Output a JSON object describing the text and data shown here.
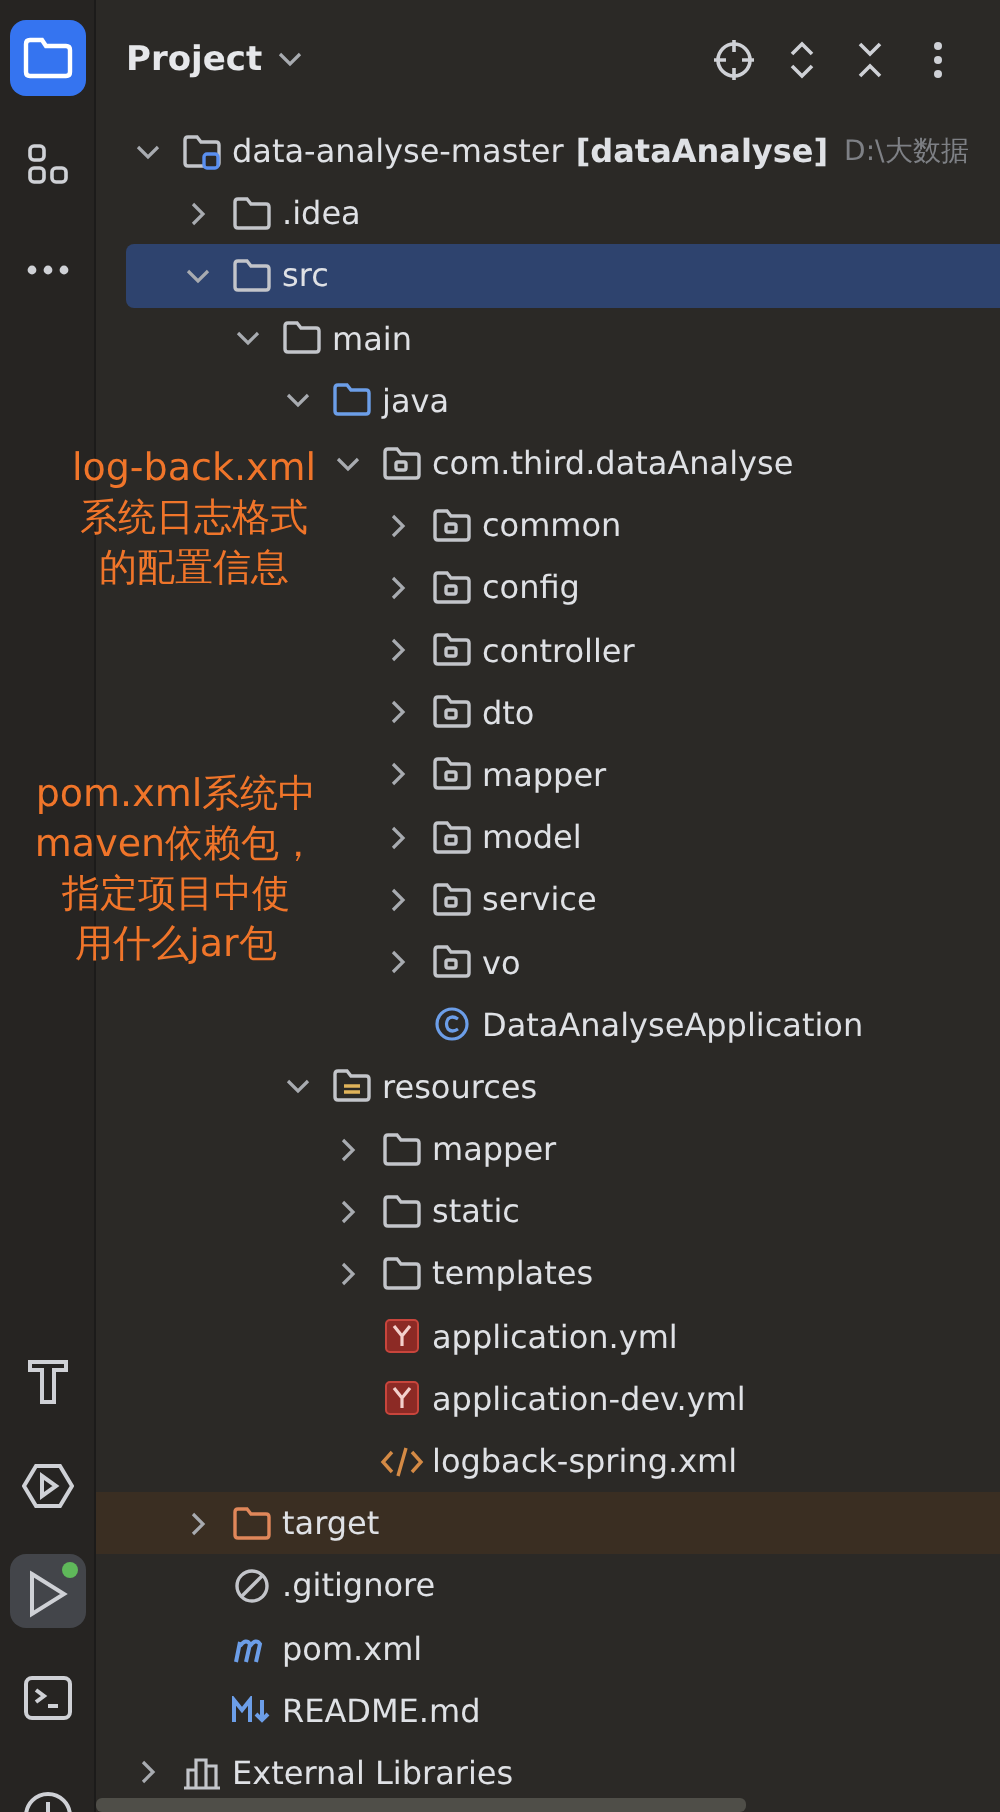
{
  "tool_strip": {
    "top": [
      {
        "kind": "project",
        "selected": true
      },
      {
        "kind": "structure",
        "selected": false
      },
      {
        "kind": "more",
        "selected": false
      }
    ],
    "bottom": [
      {
        "kind": "build",
        "selected": false,
        "status_dot": false
      },
      {
        "kind": "services",
        "selected": false,
        "status_dot": false
      },
      {
        "kind": "run",
        "selected": true,
        "status_dot": true
      },
      {
        "kind": "terminal",
        "selected": false,
        "status_dot": false
      },
      {
        "kind": "problems",
        "selected": false,
        "status_dot": false
      }
    ]
  },
  "panel": {
    "title": "Project",
    "actions": [
      {
        "kind": "locate"
      },
      {
        "kind": "expand-collapse"
      },
      {
        "kind": "collapse-all"
      },
      {
        "kind": "more"
      }
    ]
  },
  "tree": [
    {
      "kind": "module",
      "name": "data-analyse-master",
      "module": "[dataAnalyse]",
      "path": "D:\\大数据",
      "expanded": true,
      "selected": false,
      "children": [
        {
          "kind": "folder",
          "name": ".idea",
          "expanded": false,
          "selected": false
        },
        {
          "kind": "folder",
          "name": "src",
          "expanded": true,
          "selected": true,
          "children": [
            {
              "kind": "folder",
              "name": "main",
              "expanded": true,
              "selected": false,
              "children": [
                {
                  "kind": "source-folder",
                  "name": "java",
                  "expanded": true,
                  "selected": false,
                  "children": [
                    {
                      "kind": "package",
                      "name": "com.third.dataAnalyse",
                      "expanded": true,
                      "selected": false,
                      "children": [
                        {
                          "kind": "package",
                          "name": "common",
                          "expanded": false,
                          "selected": false
                        },
                        {
                          "kind": "package",
                          "name": "config",
                          "expanded": false,
                          "selected": false
                        },
                        {
                          "kind": "package",
                          "name": "controller",
                          "expanded": false,
                          "selected": false
                        },
                        {
                          "kind": "package",
                          "name": "dto",
                          "expanded": false,
                          "selected": false
                        },
                        {
                          "kind": "package",
                          "name": "mapper",
                          "expanded": false,
                          "selected": false
                        },
                        {
                          "kind": "package",
                          "name": "model",
                          "expanded": false,
                          "selected": false
                        },
                        {
                          "kind": "package",
                          "name": "service",
                          "expanded": false,
                          "selected": false
                        },
                        {
                          "kind": "package",
                          "name": "vo",
                          "expanded": false,
                          "selected": false
                        },
                        {
                          "kind": "class",
                          "name": "DataAnalyseApplication",
                          "selected": false
                        }
                      ]
                    }
                  ]
                },
                {
                  "kind": "resources-folder",
                  "name": "resources",
                  "expanded": true,
                  "selected": false,
                  "children": [
                    {
                      "kind": "folder",
                      "name": "mapper",
                      "expanded": false,
                      "selected": false
                    },
                    {
                      "kind": "folder",
                      "name": "static",
                      "expanded": false,
                      "selected": false
                    },
                    {
                      "kind": "folder",
                      "name": "templates",
                      "expanded": false,
                      "selected": false
                    },
                    {
                      "kind": "yaml",
                      "name": "application.yml",
                      "selected": false
                    },
                    {
                      "kind": "yaml",
                      "name": "application-dev.yml",
                      "selected": false
                    },
                    {
                      "kind": "xml",
                      "name": "logback-spring.xml",
                      "selected": false
                    }
                  ]
                }
              ]
            }
          ]
        },
        {
          "kind": "excluded-folder",
          "name": "target",
          "expanded": false,
          "selected": false
        },
        {
          "kind": "gitignore",
          "name": ".gitignore",
          "selected": false
        },
        {
          "kind": "maven",
          "name": "pom.xml",
          "selected": false
        },
        {
          "kind": "markdown",
          "name": "README.md",
          "selected": false
        }
      ]
    },
    {
      "kind": "library",
      "name": "External Libraries",
      "expanded": false,
      "selected": false
    }
  ],
  "annotations": [
    {
      "lines": [
        "log-back.xml",
        "系统日志格式",
        "的配置信息"
      ]
    },
    {
      "lines": [
        "pom.xml系统中",
        "maven依赖包，",
        "指定项目中使",
        "用什么jar包"
      ]
    }
  ]
}
